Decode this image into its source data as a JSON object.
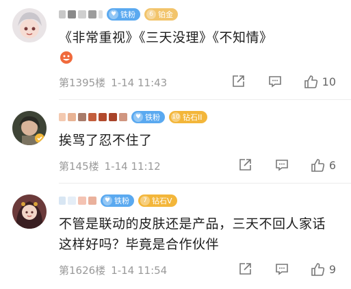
{
  "comments": [
    {
      "badges": [
        {
          "icon": "fan-icon",
          "label": "铁粉",
          "color": "#5aa9f0"
        },
        {
          "icon": "level-icon",
          "level": "6",
          "label": "铂金",
          "color": "#f2c46b"
        }
      ],
      "text": "《非常重视》《三天没理》《不知情》",
      "emoji": "smile-emoji",
      "floor": "第1395楼",
      "time": "1-14 11:43",
      "likes": "10"
    },
    {
      "badges": [
        {
          "icon": "fan-icon",
          "label": "铁粉",
          "color": "#5aa9f0"
        },
        {
          "icon": "level-icon",
          "level": "10",
          "label": "钻石II",
          "color": "#f3b63a"
        }
      ],
      "text": "挨骂了忍不住了",
      "floor": "第145楼",
      "time": "1-14 11:12",
      "likes": "6"
    },
    {
      "badges": [
        {
          "icon": "fan-icon",
          "label": "铁粉",
          "color": "#5aa9f0"
        },
        {
          "icon": "level-icon",
          "level": "7",
          "label": "钻石V",
          "color": "#f3b63a"
        }
      ],
      "text": "不管是联动的皮肤还是产品，三天不回人家话这样好吗？毕竟是合作伙伴",
      "floor": "第1626楼",
      "time": "1-14 11:54",
      "likes": "9"
    }
  ]
}
